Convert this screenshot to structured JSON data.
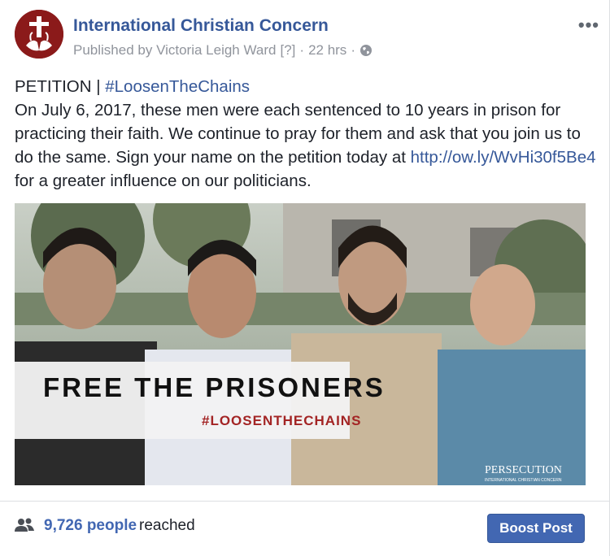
{
  "post": {
    "page_name": "International Christian Concern",
    "published_by": "Published by Victoria Leigh Ward",
    "help_marker": "[?]",
    "separator": "·",
    "time": "22 hrs",
    "audience_icon": "globe-icon",
    "more_icon": "more-dots-icon",
    "more_glyph": "•••",
    "text_line1_prefix": "PETITION | ",
    "hashtag": "#LoosenTheChains",
    "text_body": "On July 6, 2017, these men were each sentenced to 10 years in prison for practicing their faith. We continue to pray for them and ask that you join us to do the same. Sign your name on the petition today at ",
    "link": "http://ow.ly/WvHi30f5Be4",
    "text_tail": " for a greater influence on our politicians."
  },
  "image": {
    "headline": "FREE THE PRISONERS",
    "hashtag": "#LOOSENTHECHAINS",
    "logo_text": "PERSECUTION",
    "logo_sub": "INTERNATIONAL CHRISTIAN CONCERN",
    "colors": {
      "headline": "#111111",
      "hashtag": "#a32424",
      "banner": "#f2f2f2"
    }
  },
  "footer": {
    "reach_icon": "people-icon",
    "reach_count": "9,726 people",
    "reach_label": "reached",
    "boost_label": "Boost Post"
  },
  "colors": {
    "link": "#365899",
    "button": "#4267b2",
    "meta": "#90949c"
  }
}
